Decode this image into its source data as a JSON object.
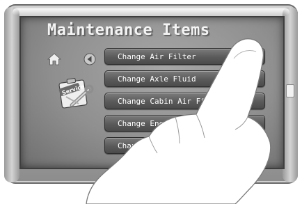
{
  "screen": {
    "title": "Maintenance Items",
    "icons": {
      "home": "home-icon",
      "back": "back-arrow-icon",
      "service": "service-wrench-clipboard-icon"
    },
    "service_label": "Service",
    "menu": [
      {
        "label": "Change Air Filter"
      },
      {
        "label": "Change Axle Fluid"
      },
      {
        "label": "Change Cabin Air Filte"
      },
      {
        "label": "Change Engine Coolar"
      },
      {
        "label": "Change Engi"
      }
    ]
  },
  "colors": {
    "screen_bg": "#9a9a9a",
    "button_bg": "#5a5a5a",
    "title_text": "#f4f4f4",
    "bezel": "#b5b5b5"
  }
}
